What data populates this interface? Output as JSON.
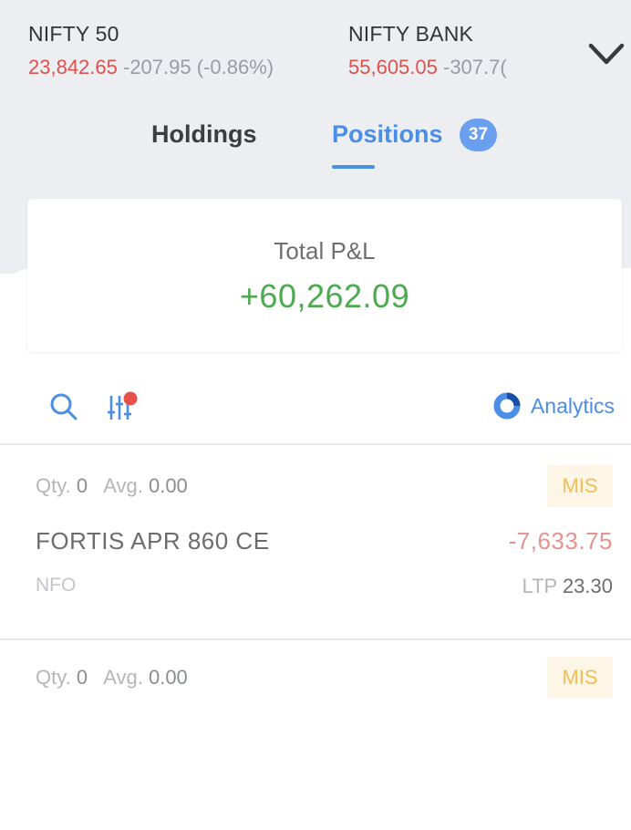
{
  "indices": [
    {
      "name": "NIFTY 50",
      "price": "23,842.65",
      "change": "-207.95 (-0.86%)"
    },
    {
      "name": "NIFTY BANK",
      "price": "55,605.05",
      "change": "-307.7("
    }
  ],
  "tabs": {
    "holdings_label": "Holdings",
    "positions_label": "Positions",
    "positions_count": "37"
  },
  "summary": {
    "label": "Total P&L",
    "value": "+60,262.09"
  },
  "toolbar": {
    "analytics_label": "Analytics"
  },
  "positions": [
    {
      "qty_label": "Qty.",
      "qty": "0",
      "avg_label": "Avg.",
      "avg": "0.00",
      "product": "MIS",
      "symbol": "FORTIS APR 860 CE",
      "pnl": "-7,633.75",
      "exchange": "NFO",
      "ltp_label": "LTP",
      "ltp": "23.30"
    },
    {
      "qty_label": "Qty.",
      "qty": "0",
      "avg_label": "Avg.",
      "avg": "0.00",
      "product": "MIS"
    }
  ],
  "colors": {
    "accent": "#4b8ee6",
    "loss": "#df514c",
    "profit": "#4caa4f",
    "product_badge": "#f3bd55"
  }
}
